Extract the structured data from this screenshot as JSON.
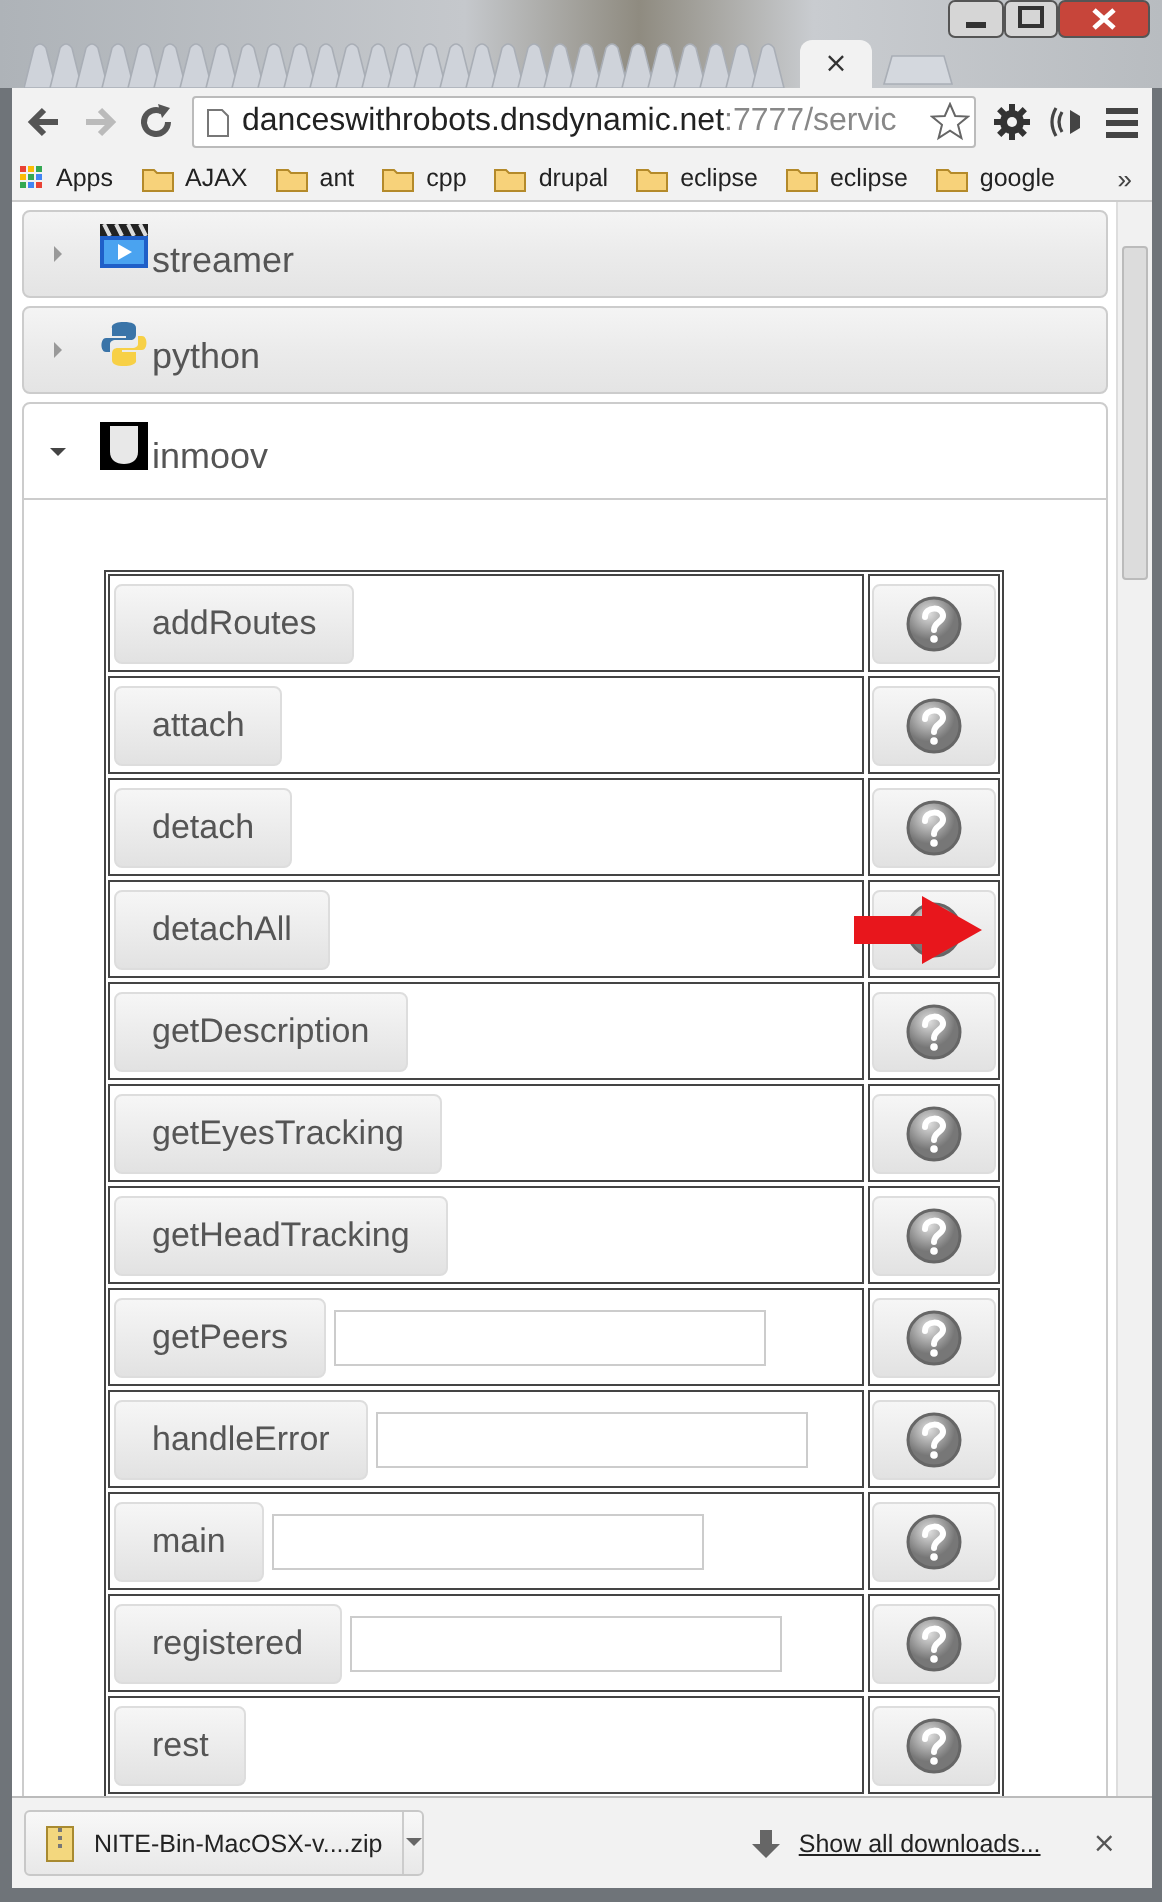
{
  "tab": {
    "close": "×"
  },
  "toolbar": {
    "url_host": "danceswithrobots.dnsdynamic.net",
    "url_rest": ":7777/servic"
  },
  "bookmarks": [
    {
      "label": "Apps",
      "kind": "apps"
    },
    {
      "label": "AJAX",
      "kind": "folder"
    },
    {
      "label": "ant",
      "kind": "folder"
    },
    {
      "label": "cpp",
      "kind": "folder"
    },
    {
      "label": "drupal",
      "kind": "folder"
    },
    {
      "label": "eclipse",
      "kind": "folder"
    },
    {
      "label": "eclipse",
      "kind": "folder"
    },
    {
      "label": "google",
      "kind": "folder"
    }
  ],
  "bookmarks_more": "»",
  "panels": [
    {
      "title": "streamer",
      "kind": "streamer",
      "expanded": false
    },
    {
      "title": "python",
      "kind": "python",
      "expanded": false
    },
    {
      "title": "inmoov",
      "kind": "robot",
      "expanded": true,
      "methods": [
        {
          "name": "addRoutes",
          "has_input": false,
          "pointed": false
        },
        {
          "name": "attach",
          "has_input": false,
          "pointed": false
        },
        {
          "name": "detach",
          "has_input": false,
          "pointed": false
        },
        {
          "name": "detachAll",
          "has_input": false,
          "pointed": true
        },
        {
          "name": "getDescription",
          "has_input": false,
          "pointed": false
        },
        {
          "name": "getEyesTracking",
          "has_input": false,
          "pointed": false
        },
        {
          "name": "getHeadTracking",
          "has_input": false,
          "pointed": false
        },
        {
          "name": "getPeers",
          "has_input": true,
          "pointed": false
        },
        {
          "name": "handleError",
          "has_input": true,
          "pointed": false
        },
        {
          "name": "main",
          "has_input": true,
          "pointed": false
        },
        {
          "name": "registered",
          "has_input": true,
          "pointed": false
        },
        {
          "name": "rest",
          "has_input": false,
          "pointed": false
        }
      ]
    }
  ],
  "downloads": {
    "file": "NITE-Bin-MacOSX-v....zip",
    "show_all": "Show all downloads...",
    "close": "×"
  }
}
